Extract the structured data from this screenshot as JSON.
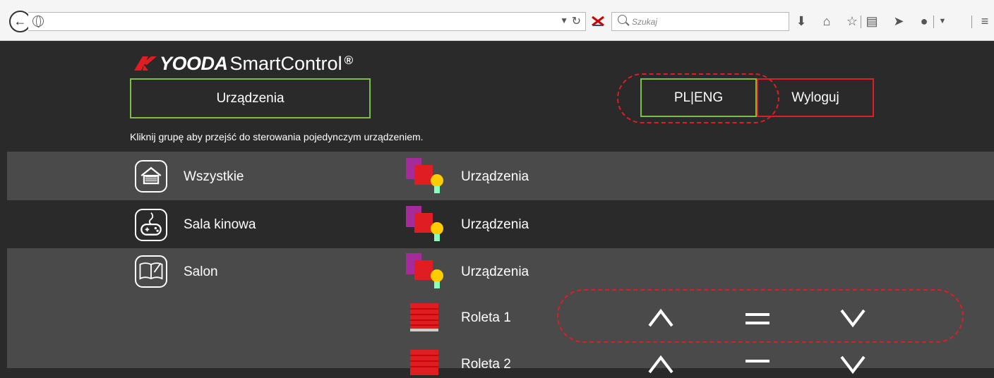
{
  "browser": {
    "search_placeholder": "Szukaj"
  },
  "header": {
    "logo_brand": "YOODA",
    "logo_product": "SmartControl",
    "logo_mark": "®",
    "devices_button": "Urządzenia",
    "lang_button": "PL|ENG",
    "logout_button": "Wyloguj",
    "hint": "Kliknij grupę aby przejść do sterowania pojedynczym urządzeniem."
  },
  "rooms": [
    {
      "name": "Wszystkie",
      "icon": "house-icon",
      "device_group": "Urządzenia"
    },
    {
      "name": "Sala kinowa",
      "icon": "gamepad-icon",
      "device_group": "Urządzenia"
    },
    {
      "name": "Salon",
      "icon": "book-icon",
      "device_group": "Urządzenia"
    }
  ],
  "devices": [
    {
      "name": "Roleta 1",
      "icon": "blind-icon"
    },
    {
      "name": "Roleta 2",
      "icon": "blind-icon"
    }
  ],
  "colors": {
    "accent_green": "#7ac142",
    "accent_red": "#e11d24",
    "bg_dark": "#2a2a2a",
    "bg_row": "#4a4a4a"
  }
}
